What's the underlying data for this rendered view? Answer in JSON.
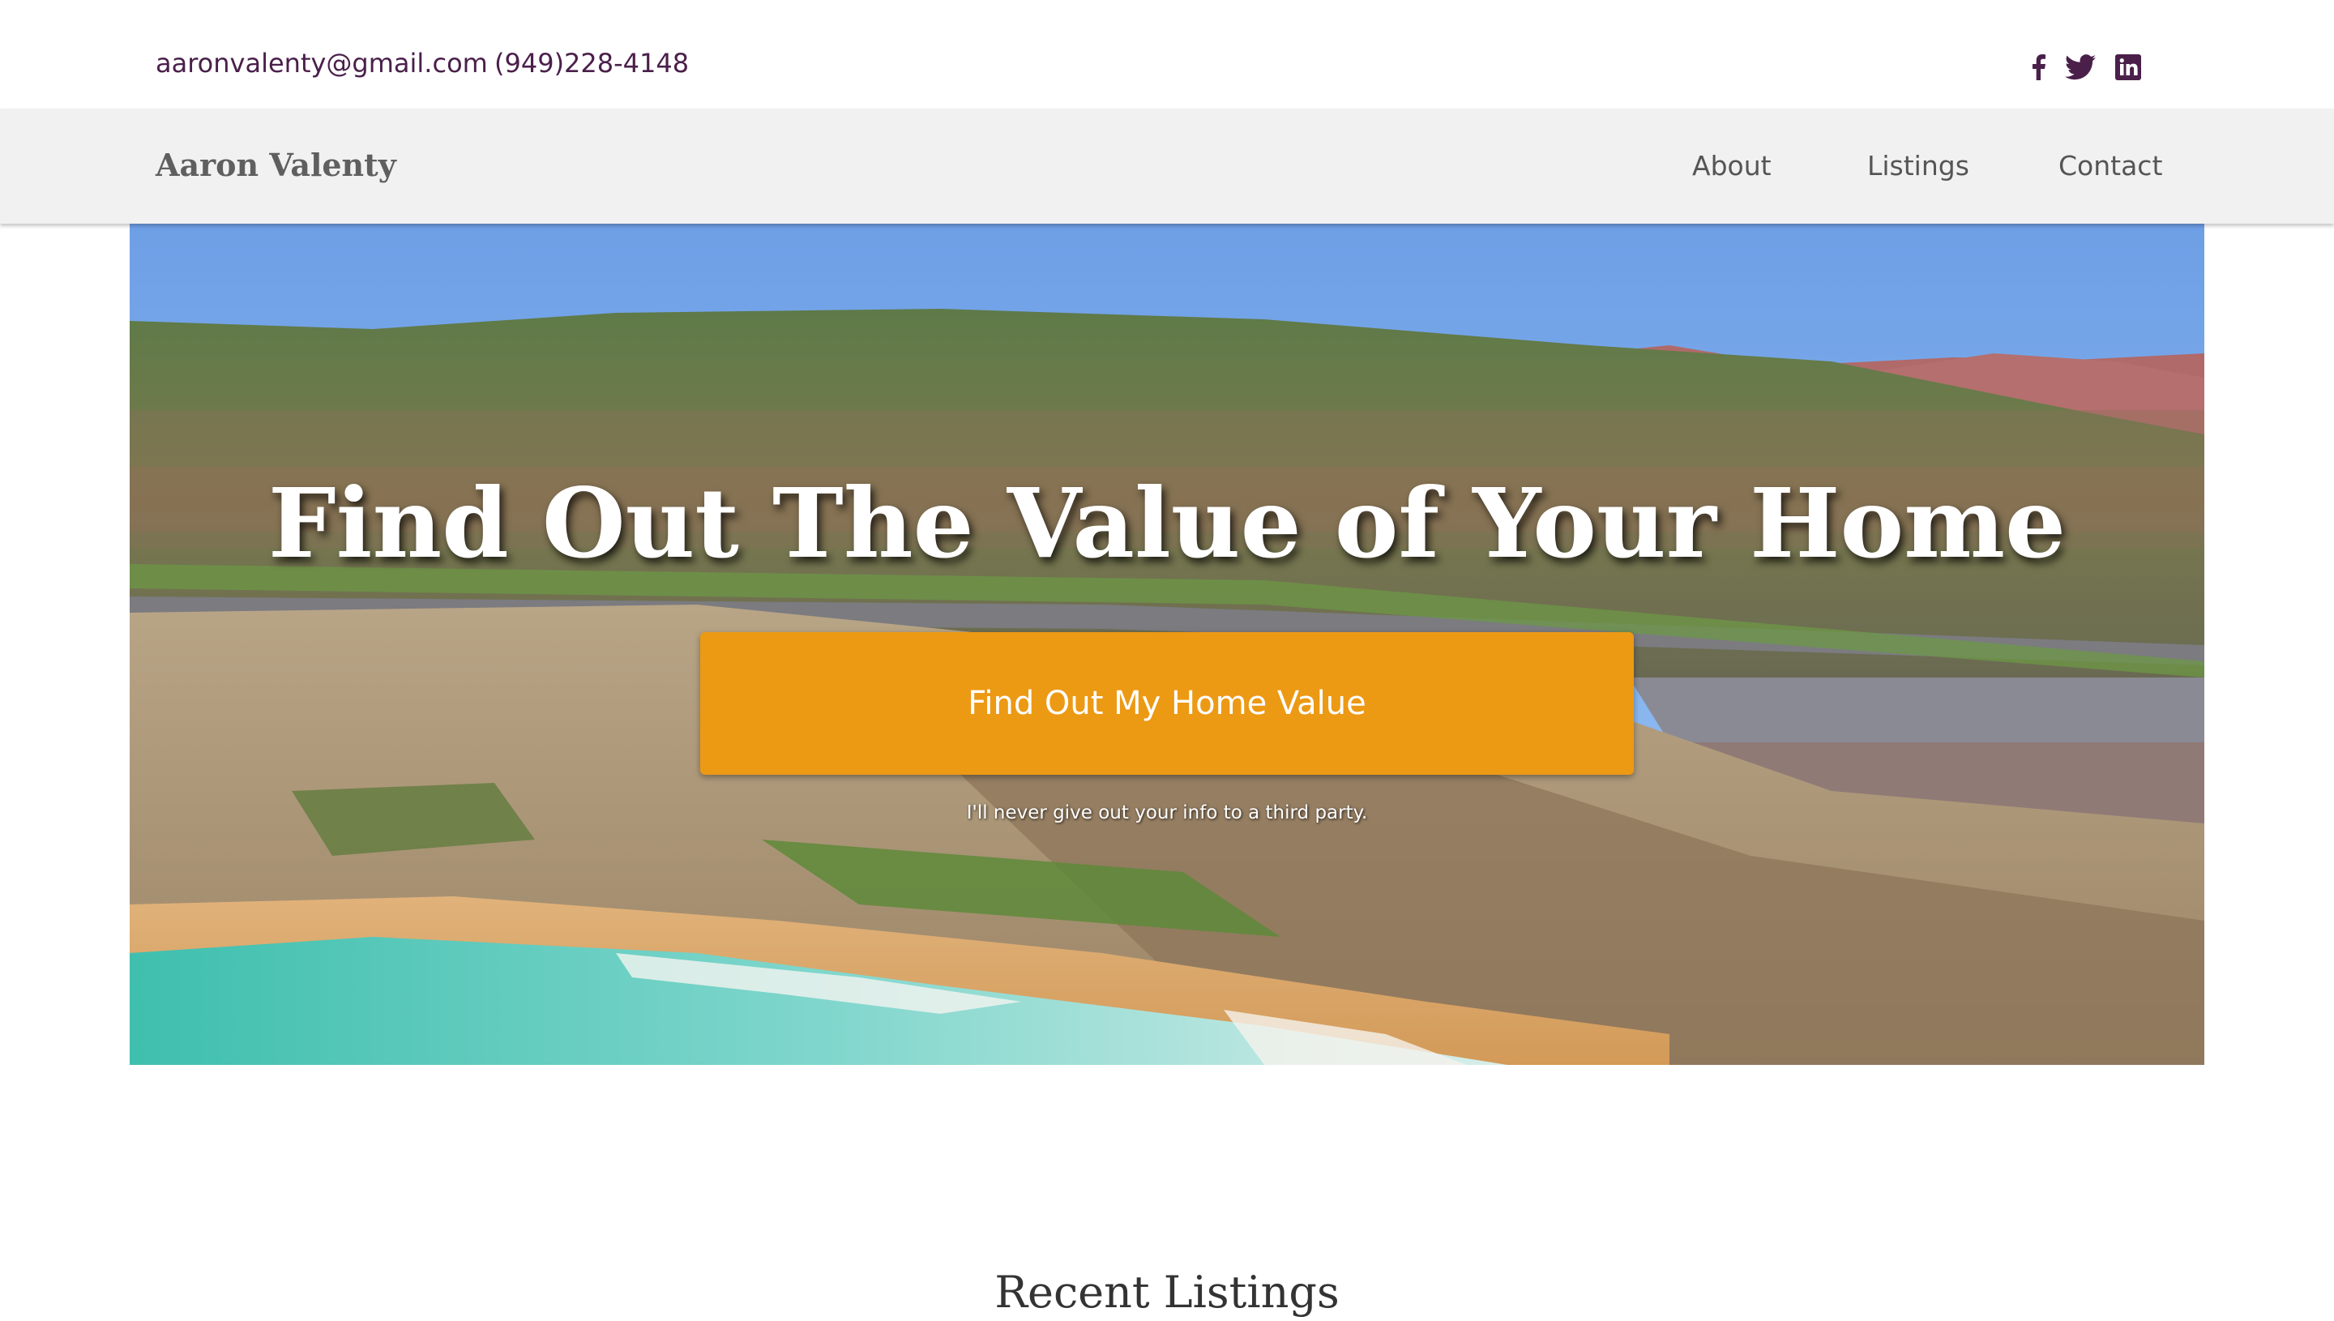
{
  "topbar": {
    "email": "aaronvalenty@gmail.com",
    "phone": "(949)228-4148",
    "social": [
      {
        "icon": "facebook-icon"
      },
      {
        "icon": "twitter-icon"
      },
      {
        "icon": "linkedin-icon"
      }
    ],
    "icon_color": "#4a1f4a"
  },
  "navbar": {
    "brand": "Aaron Valenty",
    "links": [
      {
        "label": "About"
      },
      {
        "label": "Listings"
      },
      {
        "label": "Contact"
      }
    ]
  },
  "hero": {
    "title": "Find Out The Value of Your Home",
    "cta_label": "Find Out My Home Value",
    "cta_color": "#ec9914",
    "disclaimer": "I'll never give out your info to a third party."
  },
  "sections": {
    "recent_listings_title": "Recent Listings"
  }
}
